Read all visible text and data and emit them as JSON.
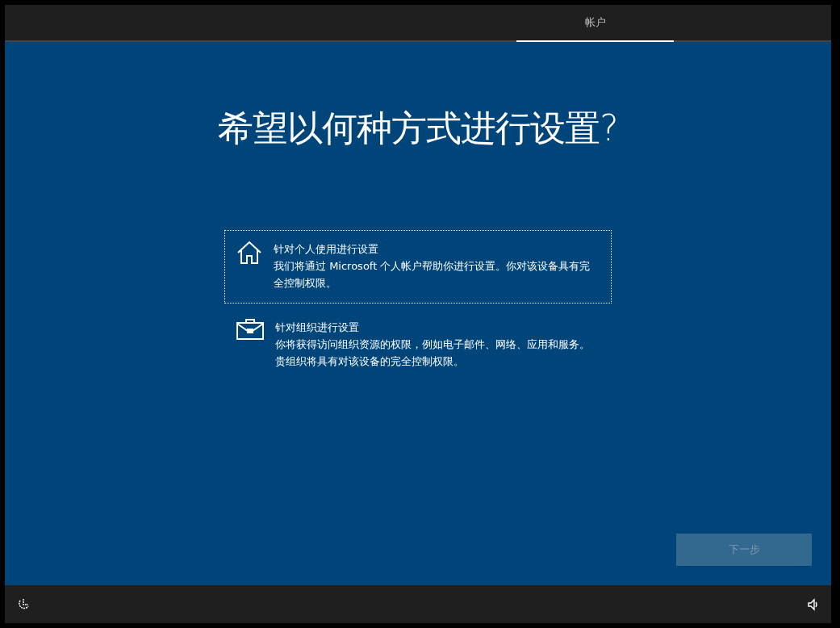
{
  "top_bar": {
    "tabs": [
      {
        "label": "帐户",
        "selected": true
      }
    ]
  },
  "heading": "希望以何种方式进行设置?",
  "options": [
    {
      "kind": "personal",
      "title": "针对个人使用进行设置",
      "description": "我们将通过 Microsoft 个人帐户帮助你进行设置。你对该设备具有完全控制权限。",
      "selected": true
    },
    {
      "kind": "organization",
      "title": "针对组织进行设置",
      "description": "你将获得访问组织资源的权限，例如电子邮件、网络、应用和服务。贵组织将具有对该设备的完全控制权限。",
      "selected": false
    }
  ],
  "next_button": {
    "label": "下一步",
    "disabled": true
  }
}
